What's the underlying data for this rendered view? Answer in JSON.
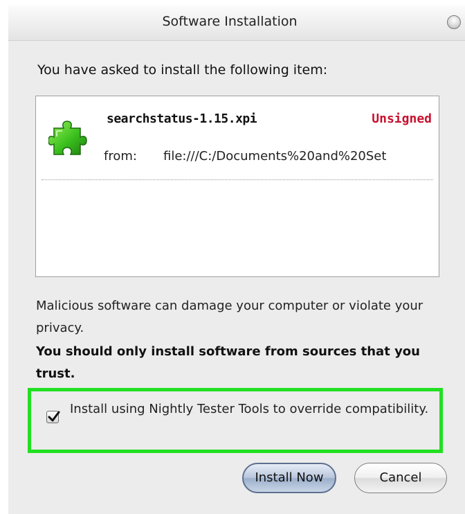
{
  "dialog": {
    "title": "Software Installation",
    "intro": "You have asked to install the following item:",
    "item": {
      "name": "searchstatus-1.15.xpi",
      "status": "Unsigned",
      "from_label": "from:",
      "from_url": "file:///C:/Documents%20and%20Set",
      "icon": "puzzle-piece-icon"
    },
    "warning": "Malicious software can damage your computer or violate your privacy.",
    "bold_warning": "You should only install software from sources that you trust.",
    "compat_option": {
      "label": "Install using Nightly Tester Tools to override compatibility.",
      "checked": true,
      "highlight_color": "#21e021"
    },
    "buttons": {
      "install": "Install Now",
      "cancel": "Cancel"
    }
  },
  "colors": {
    "unsigned": "#c8102e"
  }
}
